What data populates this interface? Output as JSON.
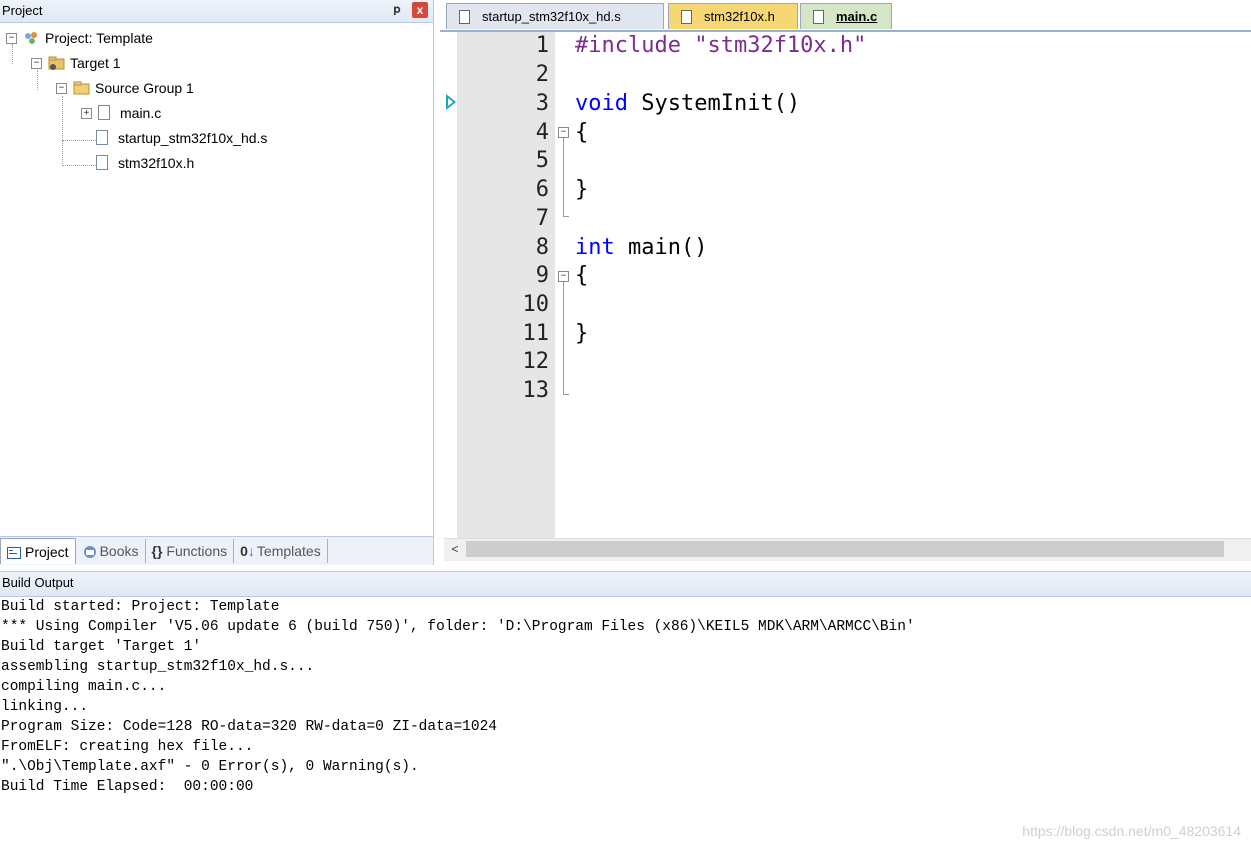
{
  "project_panel": {
    "title": "Project",
    "pin_glyph": "ᵖ",
    "close_glyph": "x",
    "tree": {
      "root": "Project: Template",
      "target": "Target 1",
      "group": "Source Group 1",
      "files": [
        "main.c",
        "startup_stm32f10x_hd.s",
        "stm32f10x.h"
      ]
    },
    "tabs": [
      {
        "label": "Project",
        "active": true
      },
      {
        "label": "Books",
        "active": false
      },
      {
        "label": "Functions",
        "active": false
      },
      {
        "label": "Templates",
        "active": false
      }
    ]
  },
  "editor": {
    "tabs": [
      {
        "label": "startup_stm32f10x_hd.s",
        "active": false,
        "color": "#dfe6f0"
      },
      {
        "label": "stm32f10x.h",
        "active": false,
        "color": "#f7d774"
      },
      {
        "label": "main.c",
        "active": true,
        "color": "#d4e6c6"
      }
    ],
    "line_numbers": [
      "1",
      "2",
      "3",
      "4",
      "5",
      "6",
      "7",
      "8",
      "9",
      "10",
      "11",
      "12",
      "13"
    ],
    "code": {
      "l1_pp": "#include",
      "l1_str": "\"stm32f10x.h\"",
      "l3_kw": "void",
      "l3_rest": " SystemInit()",
      "l4": "{",
      "l6": "}",
      "l8_kw": "int",
      "l8_rest": " main()",
      "l9": "{",
      "l11": "}"
    },
    "scroll_left_glyph": "<"
  },
  "build_output": {
    "title": "Build Output",
    "lines": [
      "Build started: Project: Template",
      "*** Using Compiler 'V5.06 update 6 (build 750)', folder: 'D:\\Program Files (x86)\\KEIL5 MDK\\ARM\\ARMCC\\Bin'",
      "Build target 'Target 1'",
      "assembling startup_stm32f10x_hd.s...",
      "compiling main.c...",
      "linking...",
      "Program Size: Code=128 RO-data=320 RW-data=0 ZI-data=1024",
      "FromELF: creating hex file...",
      "\".\\Obj\\Template.axf\" - 0 Error(s), 0 Warning(s).",
      "Build Time Elapsed:  00:00:00"
    ]
  },
  "watermark": "https://blog.csdn.net/m0_48203614"
}
